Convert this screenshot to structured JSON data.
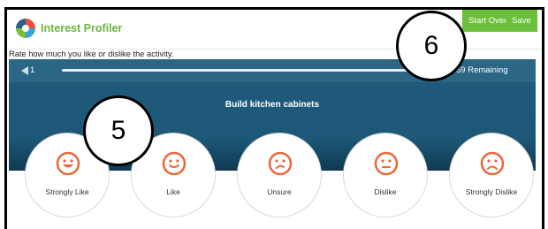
{
  "header": {
    "app_title": "Interest Profiler",
    "start_over_label": "Start Over",
    "save_label": "Save",
    "brand_color": "#6cb33f"
  },
  "instructions": "Rate how much you like or dislike the activity.",
  "progress": {
    "current": "1",
    "remaining_text": "59 Remaining"
  },
  "activity": "Build kitchen cabinets",
  "choices": [
    {
      "label": "Strongly Like",
      "icon": "big-smile-face-icon"
    },
    {
      "label": "Like",
      "icon": "smile-face-icon"
    },
    {
      "label": "Unsure",
      "icon": "unsure-face-icon"
    },
    {
      "label": "Dislike",
      "icon": "dislike-face-icon"
    },
    {
      "label": "Strongly Dislike",
      "icon": "frown-face-icon"
    }
  ],
  "callouts": [
    "5",
    "6"
  ],
  "colors": {
    "panel": "#1e5a7a",
    "face": "#e9683a",
    "button": "#6cbf3a"
  }
}
